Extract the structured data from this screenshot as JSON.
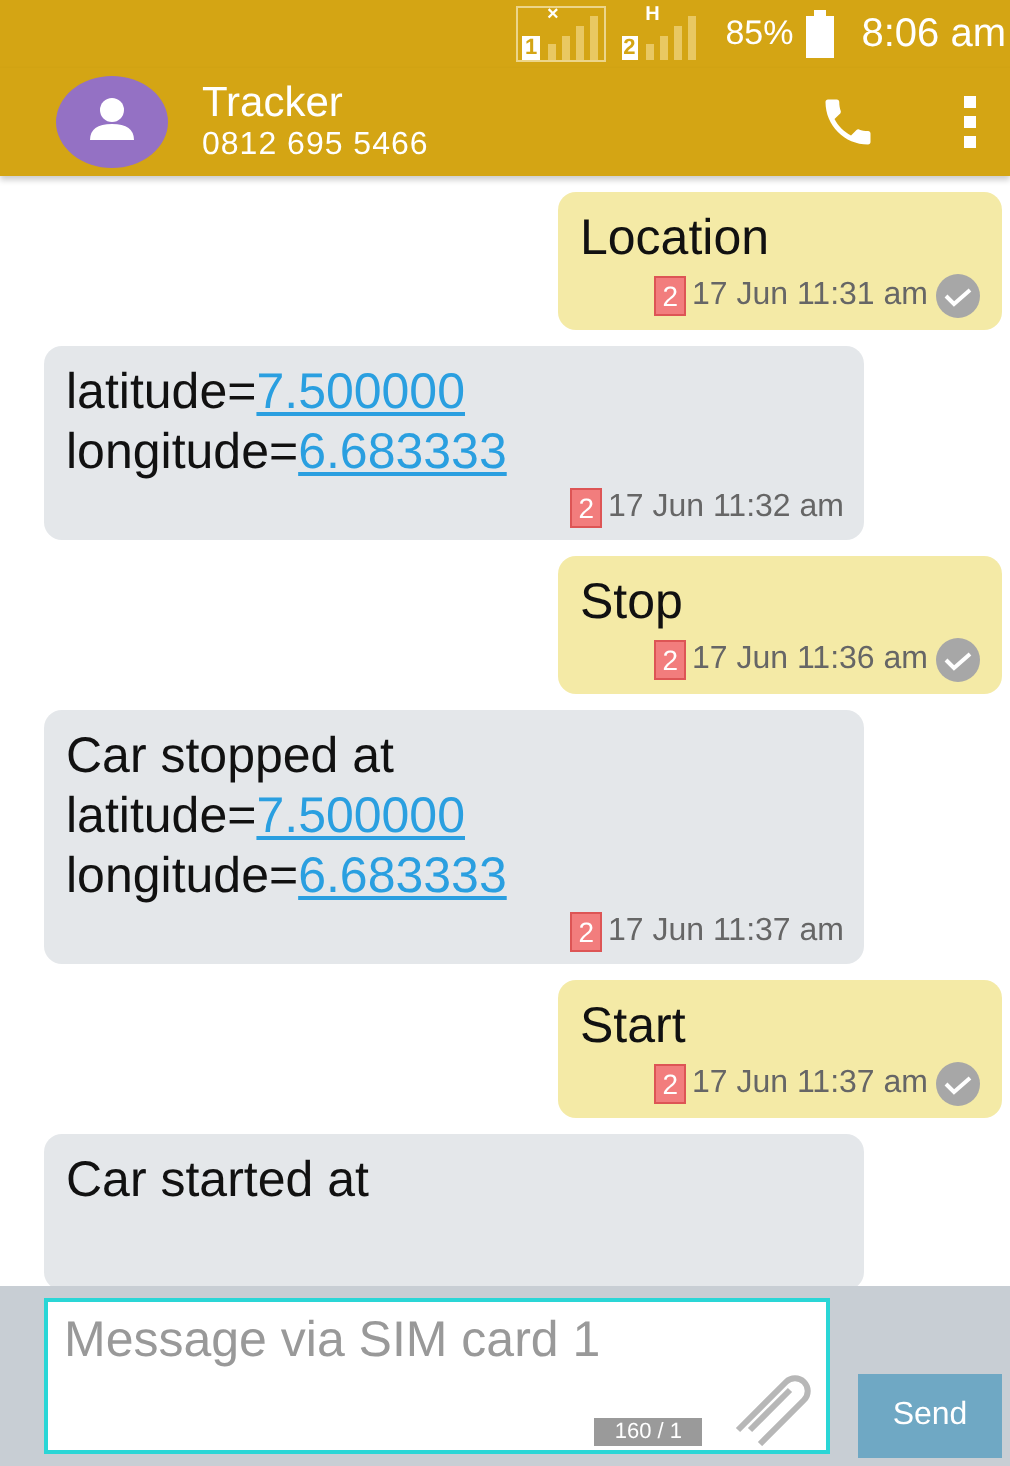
{
  "status_bar": {
    "sim_1_label": "1",
    "sim_1_badge": "×",
    "sim_2_label": "2",
    "sim_2_badge": "H",
    "battery": "85%",
    "time": "8:06 am"
  },
  "header": {
    "name": "Tracker",
    "number": "0812 695 5466"
  },
  "messages": [
    {
      "kind": "outgoing",
      "lines": [
        {
          "text": "Location"
        }
      ],
      "sim": "2",
      "time": "17 Jun 11:31 am",
      "delivered": true
    },
    {
      "kind": "incoming",
      "lines": [
        {
          "text": "latitude=",
          "link": "7.500000"
        },
        {
          "text": "longitude=",
          "link": "6.683333"
        }
      ],
      "sim": "2",
      "time": "17 Jun 11:32 am",
      "delivered": false
    },
    {
      "kind": "outgoing",
      "lines": [
        {
          "text": "Stop"
        }
      ],
      "sim": "2",
      "time": "17 Jun 11:36 am",
      "delivered": true
    },
    {
      "kind": "incoming",
      "lines": [
        {
          "text": "Car stopped at"
        },
        {
          "text": "latitude=",
          "link": "7.500000"
        },
        {
          "text": "longitude=",
          "link": "6.683333"
        }
      ],
      "sim": "2",
      "time": "17 Jun 11:37 am",
      "delivered": false
    },
    {
      "kind": "outgoing",
      "lines": [
        {
          "text": "Start"
        }
      ],
      "sim": "2",
      "time": "17 Jun 11:37 am",
      "delivered": true
    },
    {
      "kind": "incoming",
      "lines": [
        {
          "text": "Car started at"
        }
      ],
      "delivered": false
    }
  ],
  "compose": {
    "placeholder": "Message via SIM card 1",
    "counter": "160 / 1",
    "send": "Send"
  }
}
